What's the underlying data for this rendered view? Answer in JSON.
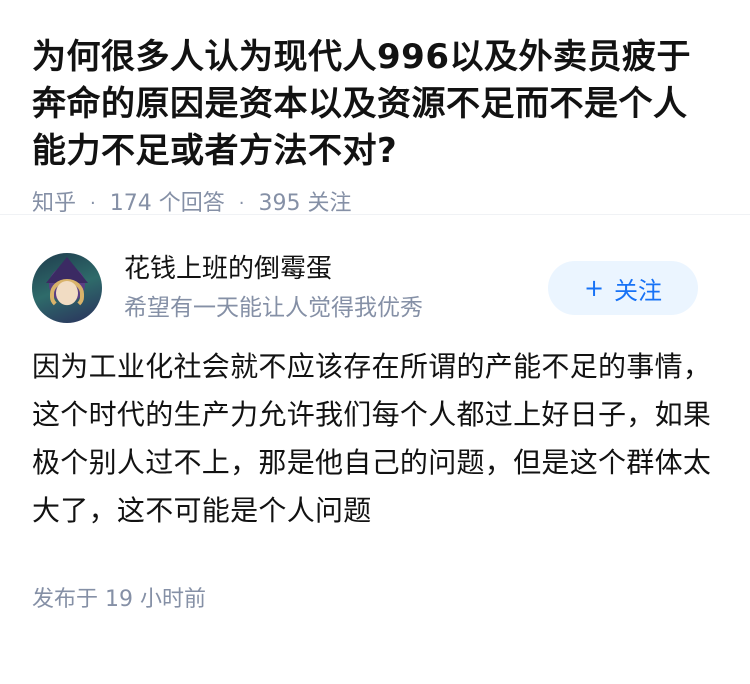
{
  "question": {
    "title": "为何很多人认为现代人996以及外卖员疲于奔命的原因是资本以及资源不足而不是个人能力不足或者方法不对?",
    "source": "知乎",
    "answer_count": "174 个回答",
    "follower_count": "395 关注"
  },
  "answer": {
    "author": {
      "name": "花钱上班的倒霉蛋",
      "bio": "希望有一天能让人觉得我优秀",
      "avatar_icon": "anime-girl-avatar"
    },
    "follow_button": {
      "plus": "+",
      "label": "关注"
    },
    "content": "因为工业化社会就不应该存在所谓的产能不足的事情，这个时代的生产力允许我们每个人都过上好日子，如果极个别人过不上，那是他自己的问题，但是这个群体太大了，这不可能是个人问题",
    "publish_time": "发布于 19 小时前"
  },
  "colors": {
    "text_primary": "#121212",
    "text_secondary": "#8590a6",
    "follow_bg": "#ebf5ff",
    "follow_text": "#1772f6"
  }
}
